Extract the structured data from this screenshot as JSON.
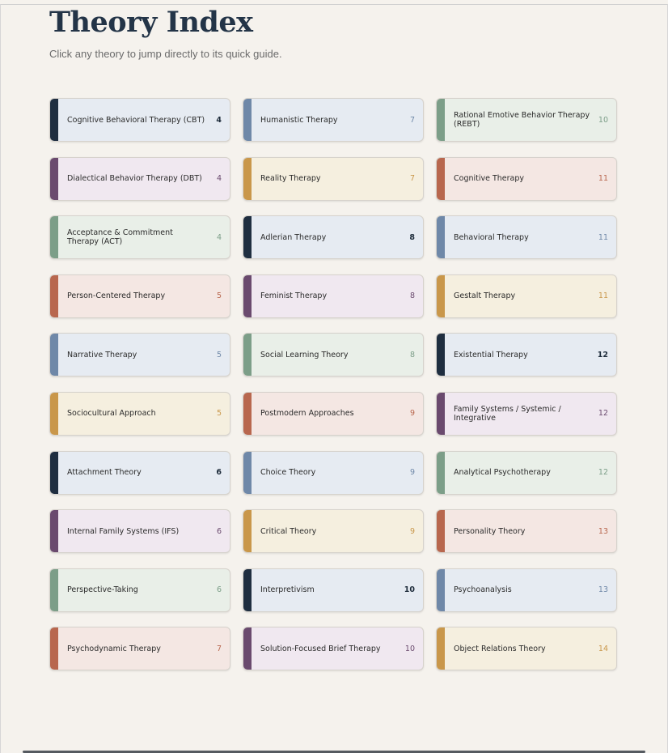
{
  "header": {
    "title": "Theory Index",
    "subtitle": "Click any theory to jump directly to its quick guide."
  },
  "palette": {
    "navy": {
      "accent": "#1f2e40",
      "bg": "#e6ebf2"
    },
    "purple": {
      "accent": "#6a4a6e",
      "bg": "#f0e8f0"
    },
    "green": {
      "accent": "#7c9e88",
      "bg": "#e9efe8"
    },
    "terracotta": {
      "accent": "#b8674e",
      "bg": "#f4e7e3"
    },
    "steel": {
      "accent": "#6f88a8",
      "bg": "#e6ebf2"
    },
    "gold": {
      "accent": "#c9974a",
      "bg": "#f5efdf"
    }
  },
  "theories": [
    {
      "name": "Cognitive Behavioral Therapy (CBT)",
      "page": "4",
      "color": "navy"
    },
    {
      "name": "Humanistic Therapy",
      "page": "7",
      "color": "steel"
    },
    {
      "name": "Rational Emotive Behavior Therapy (REBT)",
      "page": "10",
      "color": "green"
    },
    {
      "name": "Dialectical Behavior Therapy (DBT)",
      "page": "4",
      "color": "purple"
    },
    {
      "name": "Reality Therapy",
      "page": "7",
      "color": "gold"
    },
    {
      "name": "Cognitive Therapy",
      "page": "11",
      "color": "terracotta"
    },
    {
      "name": "Acceptance & Commitment Therapy (ACT)",
      "page": "4",
      "color": "green"
    },
    {
      "name": "Adlerian Therapy",
      "page": "8",
      "color": "navy"
    },
    {
      "name": "Behavioral Therapy",
      "page": "11",
      "color": "steel"
    },
    {
      "name": "Person-Centered Therapy",
      "page": "5",
      "color": "terracotta"
    },
    {
      "name": "Feminist Therapy",
      "page": "8",
      "color": "purple"
    },
    {
      "name": "Gestalt Therapy",
      "page": "11",
      "color": "gold"
    },
    {
      "name": "Narrative Therapy",
      "page": "5",
      "color": "steel"
    },
    {
      "name": "Social Learning Theory",
      "page": "8",
      "color": "green"
    },
    {
      "name": "Existential Therapy",
      "page": "12",
      "color": "navy"
    },
    {
      "name": "Sociocultural Approach",
      "page": "5",
      "color": "gold"
    },
    {
      "name": "Postmodern Approaches",
      "page": "9",
      "color": "terracotta"
    },
    {
      "name": "Family Systems / Systemic / Integrative",
      "page": "12",
      "color": "purple"
    },
    {
      "name": "Attachment Theory",
      "page": "6",
      "color": "navy"
    },
    {
      "name": "Choice Theory",
      "page": "9",
      "color": "steel"
    },
    {
      "name": "Analytical Psychotherapy",
      "page": "12",
      "color": "green"
    },
    {
      "name": "Internal Family Systems (IFS)",
      "page": "6",
      "color": "purple"
    },
    {
      "name": "Critical Theory",
      "page": "9",
      "color": "gold"
    },
    {
      "name": "Personality Theory",
      "page": "13",
      "color": "terracotta"
    },
    {
      "name": "Perspective-Taking",
      "page": "6",
      "color": "green"
    },
    {
      "name": "Interpretivism",
      "page": "10",
      "color": "navy"
    },
    {
      "name": "Psychoanalysis",
      "page": "13",
      "color": "steel"
    },
    {
      "name": "Psychodynamic Therapy",
      "page": "7",
      "color": "terracotta"
    },
    {
      "name": "Solution-Focused Brief Therapy",
      "page": "10",
      "color": "purple"
    },
    {
      "name": "Object Relations Theory",
      "page": "14",
      "color": "gold"
    }
  ]
}
